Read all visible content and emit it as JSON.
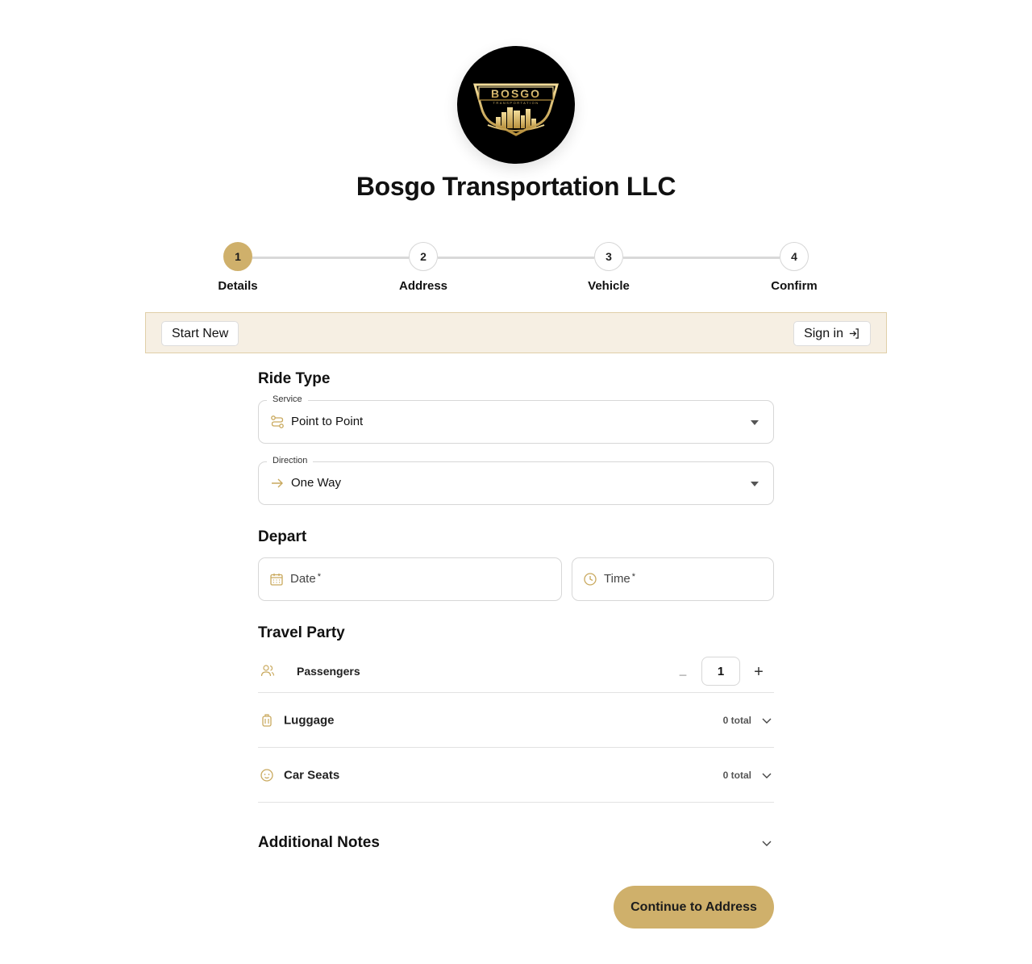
{
  "brand": {
    "logo_text": "BOSGO",
    "logo_subtext": "TRANSPORTATION",
    "company_name": "Bosgo Transportation LLC",
    "accent_color": "#cfb06b"
  },
  "stepper": {
    "current_step": 1,
    "steps": [
      {
        "number": "1",
        "label": "Details"
      },
      {
        "number": "2",
        "label": "Address"
      },
      {
        "number": "3",
        "label": "Vehicle"
      },
      {
        "number": "4",
        "label": "Confirm"
      }
    ]
  },
  "banner": {
    "start_new_label": "Start New",
    "sign_in_label": "Sign in",
    "sign_in_icon": "sign-in-icon"
  },
  "ride_type": {
    "title": "Ride Type",
    "service": {
      "legend": "Service",
      "value": "Point to Point",
      "icon": "route-icon"
    },
    "direction": {
      "legend": "Direction",
      "value": "One Way",
      "icon": "arrow-right-icon"
    }
  },
  "depart": {
    "title": "Depart",
    "date": {
      "label": "Date",
      "required_mark": "*",
      "icon": "calendar-icon"
    },
    "time": {
      "label": "Time",
      "required_mark": "*",
      "icon": "clock-icon"
    }
  },
  "travel_party": {
    "title": "Travel Party",
    "passengers": {
      "label": "Passengers",
      "value": "1",
      "decrement": "−",
      "increment": "+",
      "icon": "users-icon"
    },
    "luggage": {
      "label": "Luggage",
      "total": "0 total",
      "icon": "luggage-icon"
    },
    "car_seats": {
      "label": "Car Seats",
      "total": "0 total",
      "icon": "baby-icon"
    }
  },
  "notes": {
    "title": "Additional Notes"
  },
  "cta": {
    "label": "Continue to Address"
  }
}
